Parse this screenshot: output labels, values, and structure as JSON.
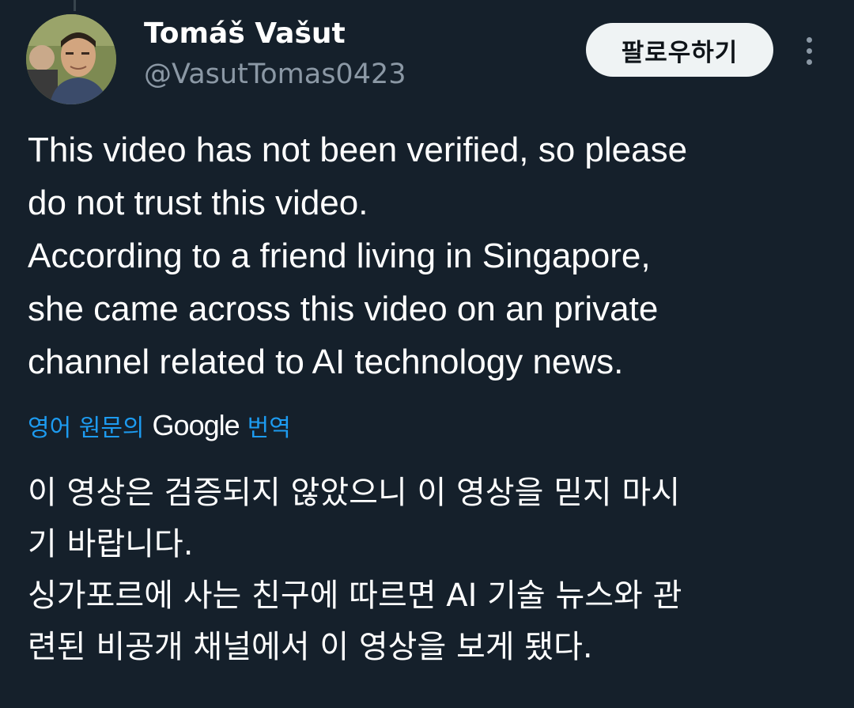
{
  "author": {
    "display_name": "Tomáš Vašut",
    "handle": "@VasutTomas0423"
  },
  "follow_button_label": "팔로우하기",
  "more_icon": "more-vertical-icon",
  "tweet": {
    "lines": [
      "This video has not been verified, so please",
      "do not trust this video.",
      "According to a friend living in Singapore,",
      "she came across this video on an private",
      "channel related to AI technology news."
    ]
  },
  "translation": {
    "prefix": "영어 원문의",
    "brand": "Google",
    "suffix": "번역",
    "lines": [
      "이 영상은 검증되지 않았으니 이 영상을 믿지 마시",
      "기 바랍니다.",
      "싱가포르에 사는 친구에 따르면 AI 기술 뉴스와 관",
      "련된 비공개 채널에서 이 영상을 보게 됐다."
    ]
  },
  "colors": {
    "background": "#15202b",
    "link": "#1d9bf0",
    "secondary_text": "#8b98a5",
    "button_bg": "#eff3f4"
  }
}
